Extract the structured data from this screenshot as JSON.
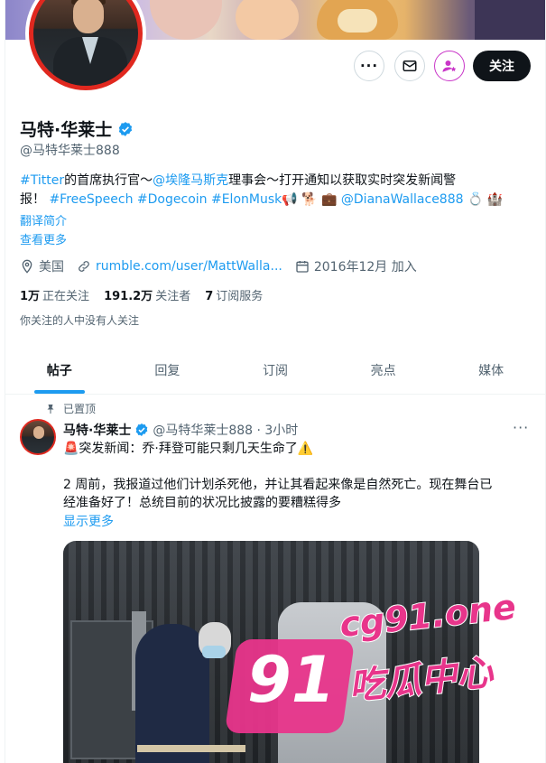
{
  "profile": {
    "name": "马特·华莱士",
    "handle": "@马特华莱士888",
    "bio_line1_parts": [
      "#Titter",
      "的首席执行官〜",
      "@埃隆马斯克",
      "理事会〜打开通知以获取实时突发新闻警"
    ],
    "bio_line2_parts": [
      "报！",
      "#FreeSpeech",
      "#Dogecoin",
      "#ElonMusk",
      "📢 🐕 💼",
      "@DianaWallace888",
      "💍 🏰"
    ],
    "translate_link": "翻译简介",
    "see_more_link": "查看更多",
    "location": "美国",
    "website": "rumble.com/user/MattWalla...",
    "joined": "2016年12月 加入",
    "following_count": "1万",
    "following_label": "正在关注",
    "followers_count": "191.2万",
    "followers_label": "关注者",
    "subscriptions_count": "7",
    "subscriptions_label": "订阅服务",
    "no_mutual": "你关注的人中没有人关注"
  },
  "actions": {
    "more_label": "···",
    "follow_label": "关注"
  },
  "tabs": [
    "帖子",
    "回复",
    "订阅",
    "亮点",
    "媒体"
  ],
  "tweet": {
    "pinned_label": "已置顶",
    "author": "马特·华莱士",
    "handle_time": "@马特华莱士888 · 3小时",
    "more": "···",
    "line1": "🚨突发新闻：乔·拜登可能只剩几天生命了⚠️",
    "line2": "2 周前，我报道过他们计划杀死他，并让其看起来像是自然死亡。现在舞台已",
    "line3": "经准备好了！总统目前的状况比披露的要糟糕得多",
    "show_more": "显示更多"
  },
  "watermark": {
    "number": "91",
    "url": "cg91.one",
    "text": "吃瓜中心"
  },
  "colors": {
    "accent": "#1d9bf0",
    "avatar_ring": "#e0281f",
    "watermark": "#e8358b"
  }
}
